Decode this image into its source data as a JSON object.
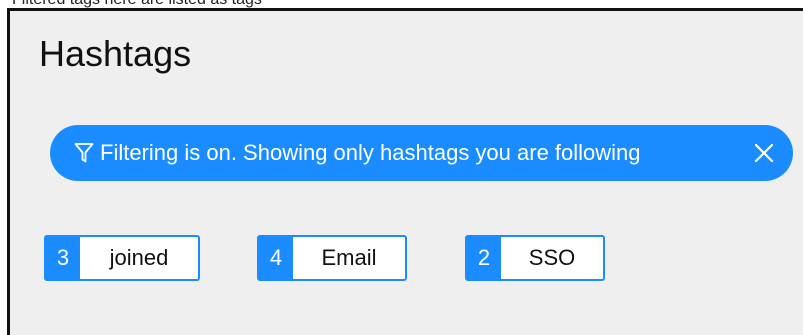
{
  "top_cutoff_text": "Filtered tags here are listed as tags",
  "panel": {
    "title": "Hashtags"
  },
  "filter_banner": {
    "icon": "filter-icon",
    "text": "Filtering is on. Showing only hashtags you are following",
    "close_icon": "close-icon",
    "color": "#1a8cff"
  },
  "hashtags": [
    {
      "count": "3",
      "label": "joined"
    },
    {
      "count": "4",
      "label": "Email"
    },
    {
      "count": "2",
      "label": "SSO"
    }
  ]
}
